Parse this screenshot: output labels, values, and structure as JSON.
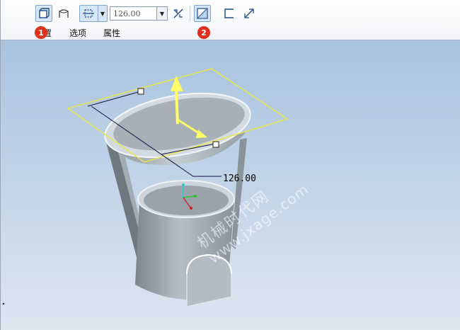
{
  "toolbar": {
    "depth_value": "126.00",
    "tabs": [
      {
        "label": "置"
      },
      {
        "label": "选项"
      },
      {
        "label": "属性"
      }
    ],
    "icons": [
      "solid-extrude-icon",
      "surface-extrude-icon",
      "depth-option-icon",
      "dropdown-arrow-icon",
      "flip-direction-icon",
      "remove-material-icon",
      "thicken-sketch-icon",
      "flip-thicken-icon"
    ]
  },
  "badges": {
    "one": "1",
    "two": "2"
  },
  "viewport": {
    "dimension_value": "126.00",
    "watermark_cn": "机械时代网",
    "watermark_url": "www.jxage.com",
    "colors": {
      "background_top": "#a9c3de",
      "background_bottom": "#dde6f1",
      "preview_outline": "#e8e840",
      "drag_handle": "#ffff66",
      "part_body": "#a8b0b8"
    }
  }
}
